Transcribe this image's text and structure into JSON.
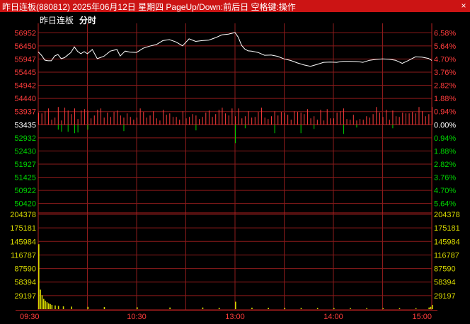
{
  "window": {
    "title": "昨日连板(880812) 2025年06月12日 星期四 PageUp/Down:前后日 空格键:操作",
    "close_label": "×"
  },
  "header": {
    "name": "昨日连板",
    "mode": "分时"
  },
  "colors": {
    "up": "#ff3c3c",
    "down": "#00d400",
    "neutral": "#ffffff",
    "volume": "#d8d800",
    "grid": "#8c1b1b",
    "price_line": "#ffffff"
  },
  "icons": {
    "close": "close-icon"
  },
  "chart_data": [
    {
      "type": "line",
      "title": "",
      "base_price": 53435,
      "y_ticks": [
        56952,
        56450,
        55947,
        55445,
        54942,
        54440,
        53937,
        53435,
        52932,
        52430,
        51927,
        51425,
        50922,
        50420
      ],
      "ylim": [
        50168,
        57203
      ],
      "pct_ticks": [
        "6.58%",
        "5.64%",
        "4.70%",
        "3.76%",
        "2.82%",
        "1.88%",
        "0.94%",
        "0.00%",
        "0.94%",
        "1.88%",
        "2.82%",
        "3.76%",
        "4.70%",
        "5.64%"
      ],
      "x_tick_labels": [
        "09:30",
        "10:30",
        "13:00",
        "14:00",
        "15:00"
      ],
      "series": [
        {
          "x": [
            0,
            2,
            4,
            6,
            8,
            10,
            12,
            14,
            16,
            18,
            20,
            22,
            24,
            26,
            28,
            30,
            33,
            36,
            40,
            44,
            48,
            50,
            53,
            56,
            60,
            64,
            68,
            72,
            76,
            80,
            84,
            88,
            92,
            96,
            100,
            104,
            108,
            112,
            116,
            120,
            122,
            124,
            126,
            128,
            130,
            134,
            138,
            142,
            146,
            150,
            154,
            158,
            162,
            166,
            170,
            174,
            178,
            182,
            186,
            190,
            194,
            198,
            202,
            206,
            210,
            214,
            218,
            222,
            226,
            230,
            234,
            238,
            240
          ],
          "values": [
            56220,
            56090,
            55905,
            55880,
            55880,
            56060,
            56120,
            55960,
            56000,
            56100,
            56200,
            56410,
            56240,
            56150,
            56230,
            56150,
            56310,
            55960,
            56050,
            56250,
            56310,
            56060,
            56250,
            56210,
            56200,
            56360,
            56440,
            56500,
            56650,
            56690,
            56600,
            56450,
            56720,
            56620,
            56650,
            56670,
            56760,
            56870,
            56900,
            56960,
            56780,
            56470,
            56330,
            56260,
            56250,
            56200,
            56090,
            56100,
            56050,
            55950,
            55890,
            55800,
            55720,
            55670,
            55740,
            55820,
            55830,
            55820,
            55860,
            55860,
            55850,
            55820,
            55900,
            55930,
            55950,
            55940,
            55900,
            55780,
            55900,
            56030,
            56020,
            55970,
            55890
          ]
        }
      ]
    },
    {
      "type": "bar",
      "title": "",
      "y_ticks": [
        204378,
        175181,
        145984,
        116787,
        87590,
        58394,
        29197
      ],
      "ylim": [
        0,
        204378
      ],
      "series": [
        {
          "x": [
            0,
            1,
            2,
            3,
            4,
            5,
            6,
            7,
            8,
            10,
            12,
            15,
            20,
            30,
            40,
            60,
            80,
            100,
            110,
            120,
            130,
            140,
            150,
            160,
            170,
            180,
            190,
            200,
            210,
            220,
            230,
            238,
            239,
            240
          ],
          "values": [
            140000,
            42000,
            30000,
            22000,
            18000,
            15000,
            12500,
            11000,
            9000,
            8000,
            7000,
            6000,
            5500,
            5000,
            4500,
            4000,
            3500,
            3500,
            3000,
            16000,
            3200,
            3000,
            2900,
            2700,
            2600,
            2500,
            2400,
            2300,
            2200,
            2200,
            2300,
            3500,
            5000,
            9000
          ]
        }
      ]
    }
  ]
}
